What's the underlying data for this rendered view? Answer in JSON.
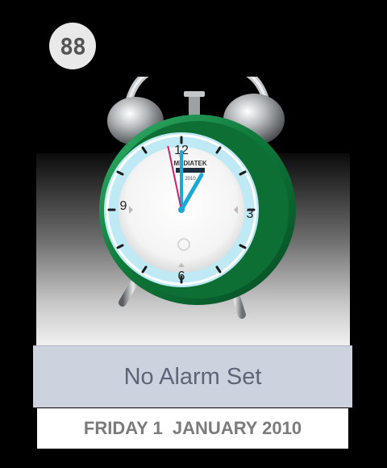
{
  "badge": {
    "text": "88"
  },
  "clock": {
    "numbers": {
      "twelve": "12",
      "three": "3",
      "six": "6",
      "nine": "9"
    },
    "brand": "MEDIATEK",
    "brand_sub": "2010",
    "time": {
      "hour": 1,
      "minute": 0,
      "second": 58
    },
    "colors": {
      "body": "#0f7a3a",
      "hands": "#19a9d6",
      "second_hand": "#d0206a",
      "bezel": "#bfe9f5"
    }
  },
  "alarm": {
    "status": "No Alarm Set"
  },
  "date": {
    "text": "FRIDAY 1  JANUARY 2010"
  }
}
